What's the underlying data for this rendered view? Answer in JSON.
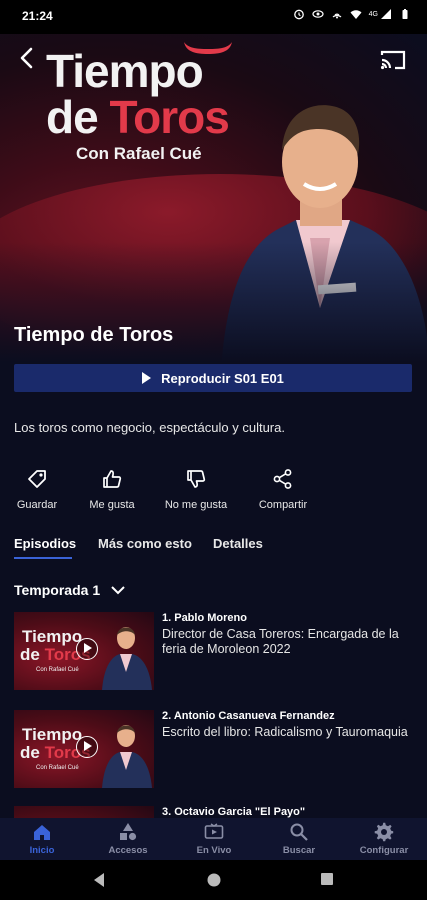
{
  "status_bar": {
    "time": "21:24",
    "icons": [
      "alarm-icon",
      "eye-icon",
      "wifi-call-icon",
      "wifi-icon",
      "signal-icon",
      "battery-icon"
    ],
    "network_label": "4G"
  },
  "hero": {
    "logo": {
      "line1": "Tiempo",
      "line2_de": "de",
      "line2_toros": "Toros",
      "line3": "Con Rafael Cué"
    }
  },
  "show": {
    "title": "Tiempo de Toros",
    "play_label": "Reproducir S01  E01",
    "description": "Los toros como negocio, espectáculo y cultura."
  },
  "actions": [
    {
      "label": "Guardar",
      "icon": "tag-icon"
    },
    {
      "label": "Me gusta",
      "icon": "thumbs-up-icon"
    },
    {
      "label": "No me gusta",
      "icon": "thumbs-down-icon"
    },
    {
      "label": "Compartir",
      "icon": "share-icon"
    }
  ],
  "tabs": [
    {
      "label": "Episodios",
      "active": true
    },
    {
      "label": "Más como esto",
      "active": false
    },
    {
      "label": "Detalles",
      "active": false
    }
  ],
  "season": {
    "label": "Temporada 1"
  },
  "thumbnail_logo": {
    "line1": "Tiempo",
    "de": "de",
    "toros": "Toros",
    "line3": "Con Rafael Cué"
  },
  "episodes": [
    {
      "title": "1. Pablo Moreno",
      "subtitle": "Director de Casa Toreros: Encargada de la feria de Moroleon 2022"
    },
    {
      "title": "2. Antonio Casanueva Fernandez",
      "subtitle": "Escrito del libro: Radicalismo y Tauromaquia"
    },
    {
      "title": "3. Octavio Garcia \"El Payo\"",
      "subtitle": ""
    }
  ],
  "bottom_nav": [
    {
      "label": "Inicio",
      "icon": "home-icon",
      "active": true
    },
    {
      "label": "Accesos",
      "icon": "shapes-icon",
      "active": false
    },
    {
      "label": "En Vivo",
      "icon": "live-tv-icon",
      "active": false
    },
    {
      "label": "Buscar",
      "icon": "search-icon",
      "active": false
    },
    {
      "label": "Configurar",
      "icon": "gear-icon",
      "active": false
    }
  ],
  "colors": {
    "background": "#0b0d1f",
    "accent_blue": "#3a63d8",
    "play_button": "#1a2a6b",
    "brand_red": "#e23a4a"
  }
}
